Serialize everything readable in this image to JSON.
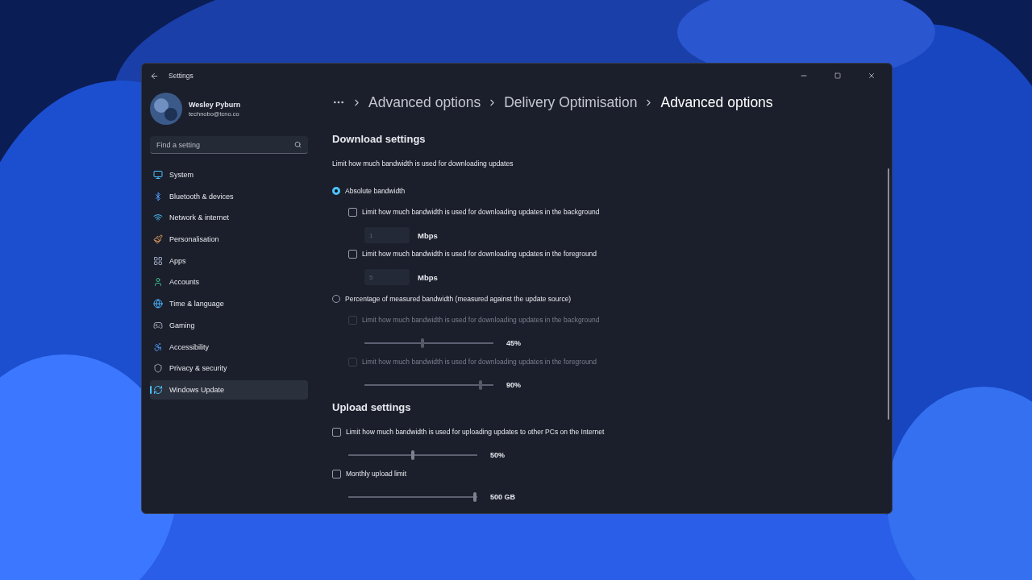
{
  "window": {
    "title": "Settings"
  },
  "user": {
    "name": "Wesley Pyburn",
    "email": "technobo@tcno.co"
  },
  "search": {
    "placeholder": "Find a setting"
  },
  "sidebar": {
    "items": [
      {
        "label": "System",
        "kind": "system",
        "selected": false
      },
      {
        "label": "Bluetooth & devices",
        "kind": "bluetooth",
        "selected": false
      },
      {
        "label": "Network & internet",
        "kind": "network",
        "selected": false
      },
      {
        "label": "Personalisation",
        "kind": "brush",
        "selected": false
      },
      {
        "label": "Apps",
        "kind": "apps",
        "selected": false
      },
      {
        "label": "Accounts",
        "kind": "person",
        "selected": false
      },
      {
        "label": "Time & language",
        "kind": "globe",
        "selected": false
      },
      {
        "label": "Gaming",
        "kind": "gamepad",
        "selected": false
      },
      {
        "label": "Accessibility",
        "kind": "accessibility",
        "selected": false
      },
      {
        "label": "Privacy & security",
        "kind": "shield",
        "selected": false
      },
      {
        "label": "Windows Update",
        "kind": "update",
        "selected": true
      }
    ]
  },
  "breadcrumb": [
    "Advanced options",
    "Delivery Optimisation",
    "Advanced options"
  ],
  "download": {
    "title": "Download settings",
    "description": "Limit how much bandwidth is used for downloading updates",
    "options": [
      {
        "label": "Absolute bandwidth",
        "selected": true,
        "limits": [
          {
            "label": "Limit how much bandwidth is used for downloading updates in the background",
            "checked": false,
            "disabled": false,
            "kind": "number",
            "value": "1",
            "unit": "Mbps"
          },
          {
            "label": "Limit how much bandwidth is used for downloading updates in the foreground",
            "checked": false,
            "disabled": false,
            "kind": "number",
            "value": "5",
            "unit": "Mbps"
          }
        ]
      },
      {
        "label": "Percentage of measured bandwidth (measured against the update source)",
        "selected": false,
        "limits": [
          {
            "label": "Limit how much bandwidth is used for downloading updates in the background",
            "checked": false,
            "disabled": true,
            "kind": "slider",
            "level": 0.45,
            "reading": "45%"
          },
          {
            "label": "Limit how much bandwidth is used for downloading updates in the foreground",
            "checked": false,
            "disabled": true,
            "kind": "slider",
            "level": 0.9,
            "reading": "90%"
          }
        ]
      }
    ]
  },
  "upload": {
    "title": "Upload settings",
    "limits": [
      {
        "label": "Limit how much bandwidth is used for uploading updates to other PCs on the Internet",
        "checked": false,
        "disabled": false,
        "kind": "slider",
        "level": 0.5,
        "reading": "50%"
      },
      {
        "label": "Monthly upload limit",
        "checked": false,
        "disabled": false,
        "kind": "slider",
        "level": 0.98,
        "reading": "500 GB"
      }
    ]
  }
}
